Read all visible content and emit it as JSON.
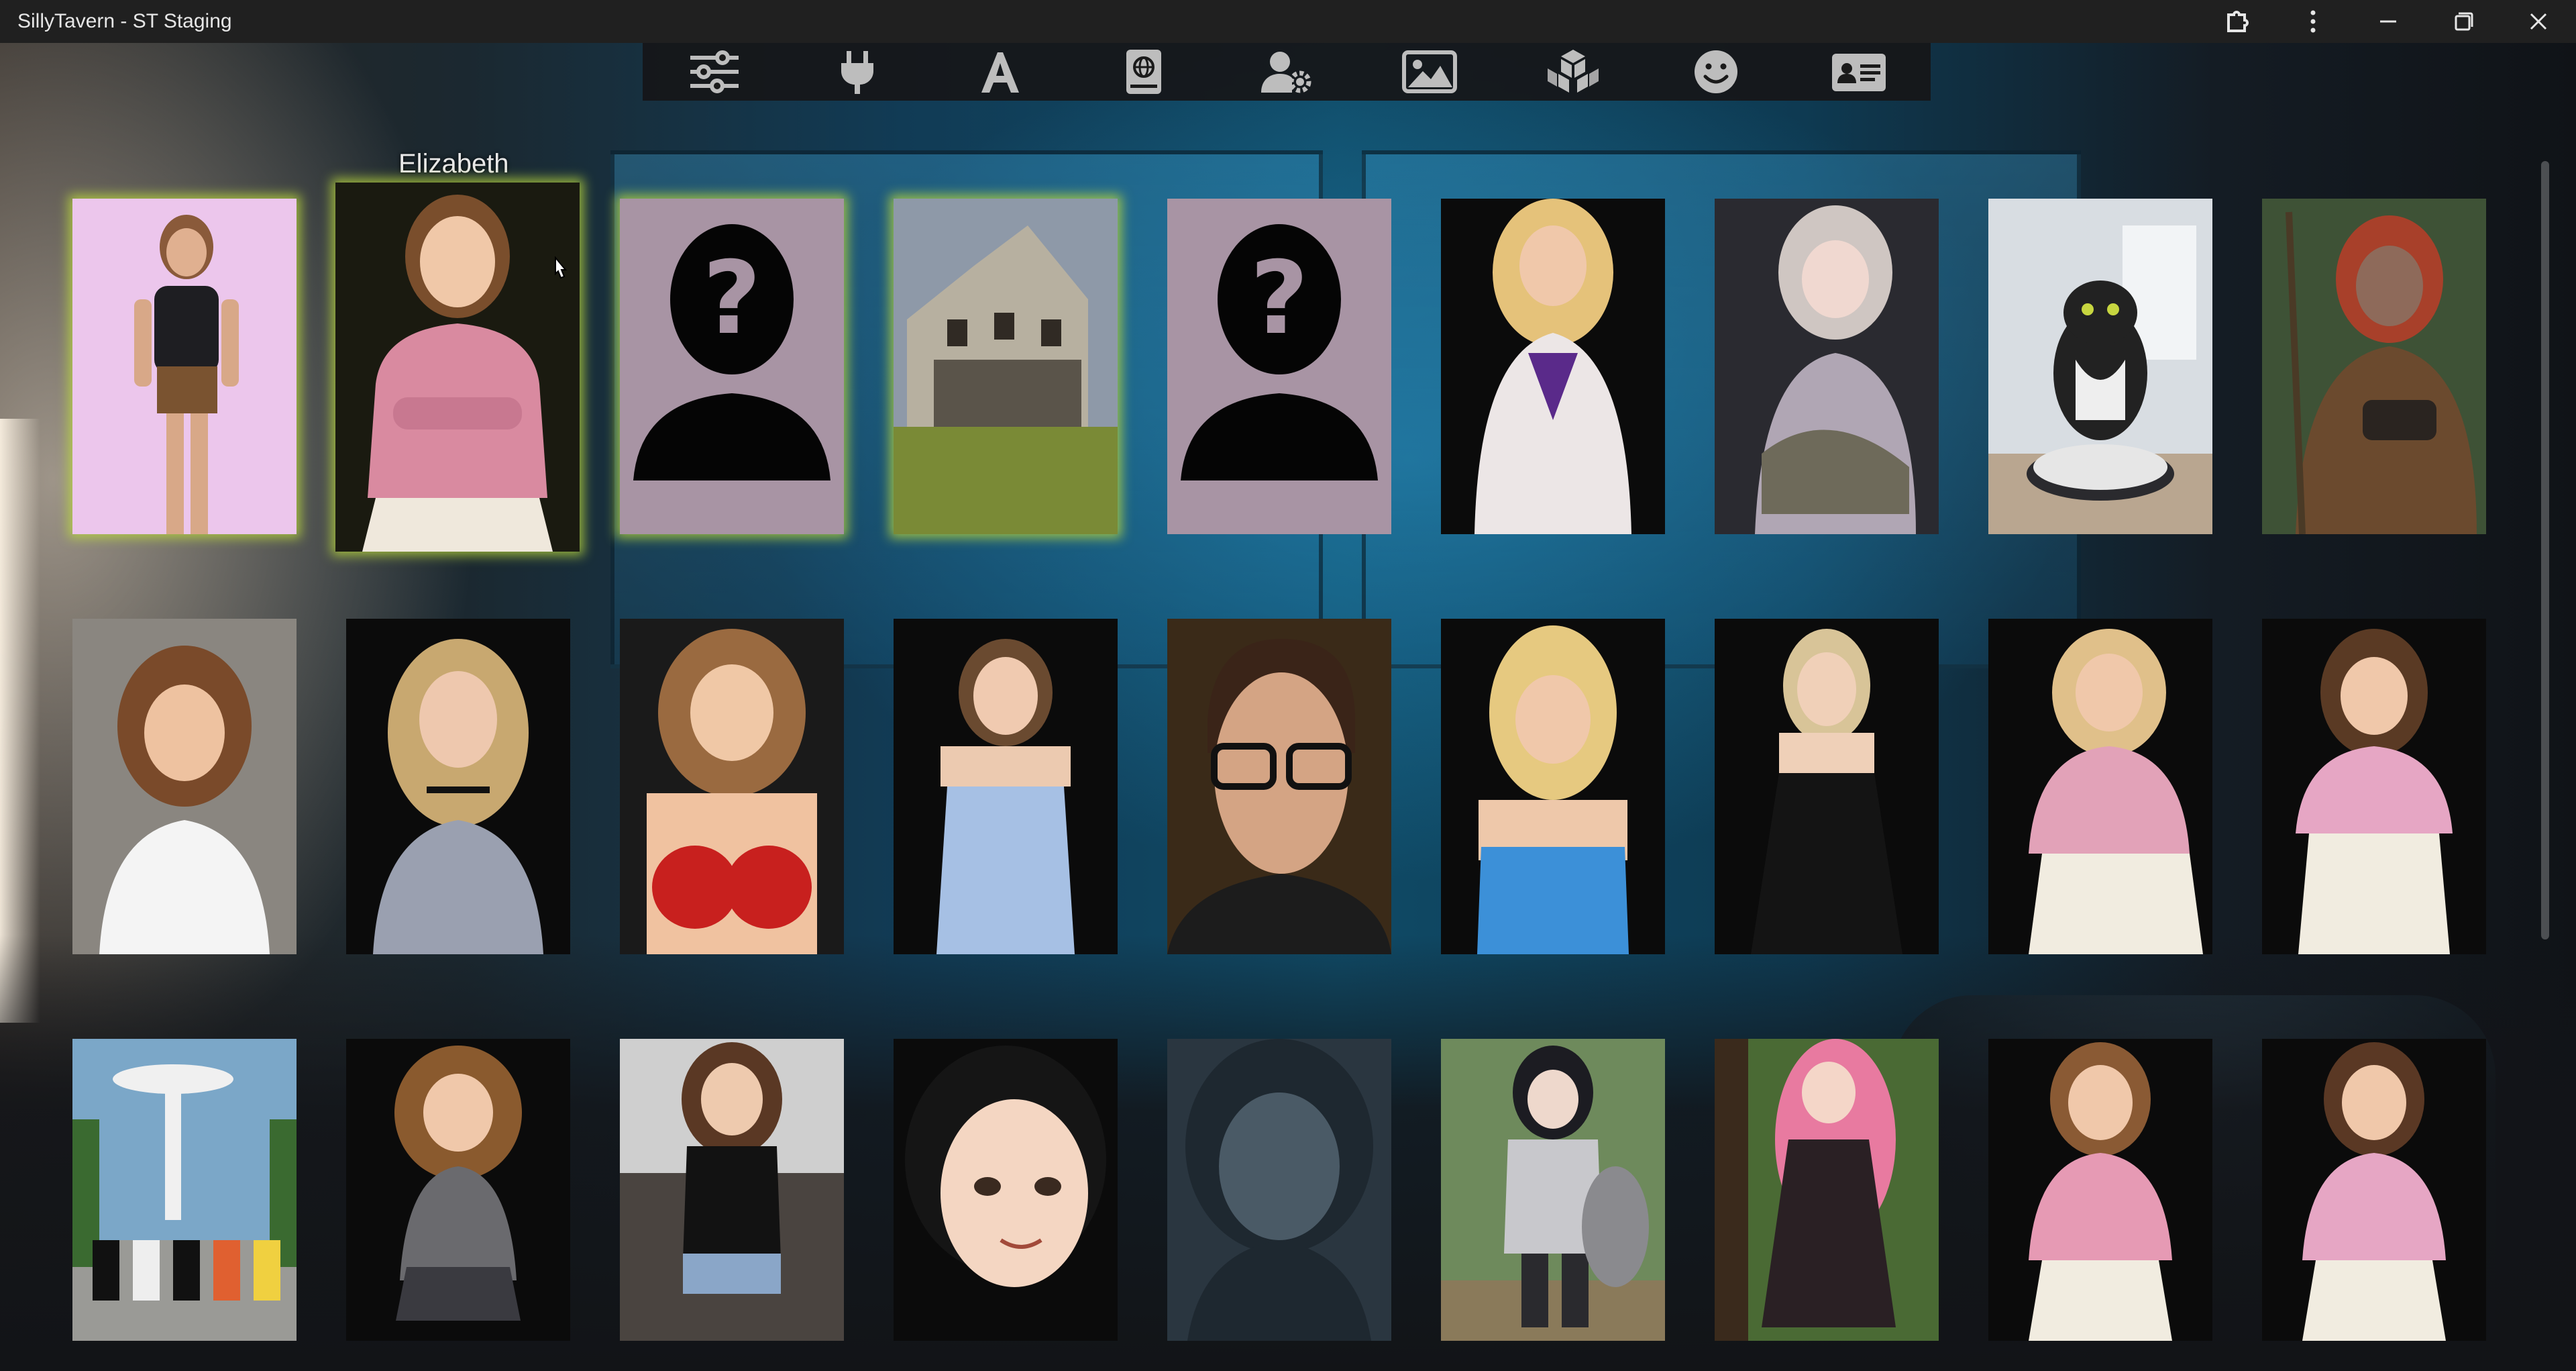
{
  "window": {
    "title": "SillyTavern - ST Staging",
    "controls": [
      "extension-icon",
      "more-options-icon",
      "minimize-icon",
      "maximize-icon",
      "close-icon"
    ]
  },
  "topnav": {
    "icons": [
      "sliders-icon",
      "plug-icon",
      "font-icon",
      "book-globe-icon",
      "user-settings-icon",
      "image-icon",
      "cubes-icon",
      "smiley-icon",
      "id-card-icon"
    ]
  },
  "hovered_card": {
    "name": "Elizabeth"
  },
  "cards": [
    {
      "row": 1,
      "col": 1,
      "subject": "woman in leather top",
      "bg": "#ecc6ec",
      "glow": true
    },
    {
      "row": 1,
      "col": 2,
      "subject": "Elizabeth",
      "bg": "#1a1a10",
      "glow": true,
      "hover": true
    },
    {
      "row": 1,
      "col": 3,
      "subject": "placeholder",
      "bg": "#a894a4",
      "glow": true
    },
    {
      "row": 1,
      "col": 4,
      "subject": "abandoned house",
      "bg": "#6e7a3a",
      "glow": true
    },
    {
      "row": 1,
      "col": 5,
      "subject": "placeholder",
      "bg": "#a894a4"
    },
    {
      "row": 1,
      "col": 6,
      "subject": "woman in lab coat",
      "bg": "#0b0b0b"
    },
    {
      "row": 1,
      "col": 7,
      "subject": "anime girl sitting",
      "bg": "#2a2a30"
    },
    {
      "row": 1,
      "col": 8,
      "subject": "cat on robot vacuum",
      "bg": "#cfd4d8"
    },
    {
      "row": 1,
      "col": 9,
      "subject": "red-haired warrior",
      "bg": "#3a4a30"
    },
    {
      "row": 2,
      "col": 1,
      "subject": "girl white shirt",
      "bg": "#8a8680"
    },
    {
      "row": 2,
      "col": 2,
      "subject": "blonde woman",
      "bg": "#0b0b0b"
    },
    {
      "row": 2,
      "col": 3,
      "subject": "woman red top",
      "bg": "#1a1a1a"
    },
    {
      "row": 2,
      "col": 4,
      "subject": "woman blue dress",
      "bg": "#0b0b0b"
    },
    {
      "row": 2,
      "col": 5,
      "subject": "man with glasses",
      "bg": "#3a2a18"
    },
    {
      "row": 2,
      "col": 6,
      "subject": "blonde blue top",
      "bg": "#0b0b0b"
    },
    {
      "row": 2,
      "col": 7,
      "subject": "woman black dress",
      "bg": "#0b0b0b"
    },
    {
      "row": 2,
      "col": 8,
      "subject": "blonde pink top",
      "bg": "#0b0b0b"
    },
    {
      "row": 2,
      "col": 9,
      "subject": "woman pink top",
      "bg": "#0b0b0b"
    },
    {
      "row": 3,
      "col": 1,
      "subject": "group of women",
      "bg": "#7ba7c8"
    },
    {
      "row": 3,
      "col": 2,
      "subject": "anime curly hair",
      "bg": "#0b0b0b"
    },
    {
      "row": 3,
      "col": 3,
      "subject": "woman black tank",
      "bg": "#cfcfcf"
    },
    {
      "row": 3,
      "col": 4,
      "subject": "anime black hair",
      "bg": "#0b0b0b"
    },
    {
      "row": 3,
      "col": 5,
      "subject": "dim anime girl",
      "bg": "#2a3640"
    },
    {
      "row": 3,
      "col": 6,
      "subject": "armored anime girl",
      "bg": "#4d6a40"
    },
    {
      "row": 3,
      "col": 7,
      "subject": "pink hair girl",
      "bg": "#3a4a28"
    },
    {
      "row": 3,
      "col": 8,
      "subject": "woman pink scrubs",
      "bg": "#0b0b0b"
    },
    {
      "row": 3,
      "col": 9,
      "subject": "woman pink blouse",
      "bg": "#0b0b0b"
    }
  ]
}
